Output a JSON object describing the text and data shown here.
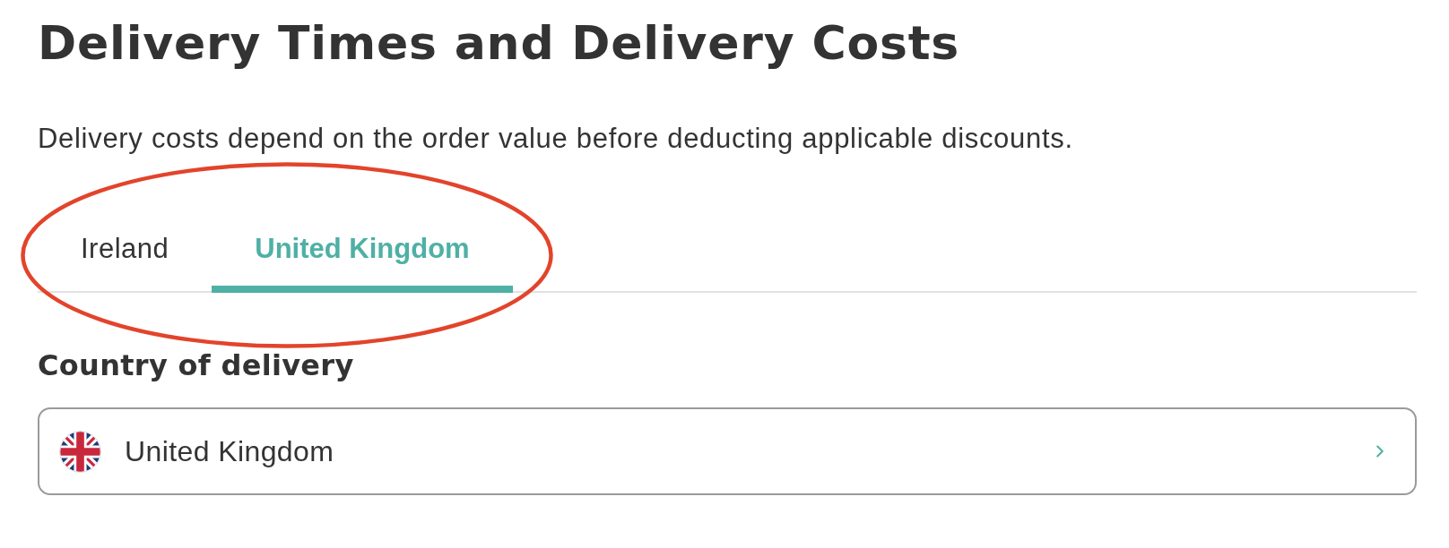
{
  "heading": "Delivery Times and Delivery Costs",
  "intro": "Delivery costs depend on the order value before deducting applicable discounts.",
  "tabs": [
    {
      "label": "Ireland",
      "selected": false
    },
    {
      "label": "United Kingdom",
      "selected": true
    }
  ],
  "country_section": {
    "title": "Country of delivery",
    "selector": {
      "value": "United Kingdom"
    }
  }
}
